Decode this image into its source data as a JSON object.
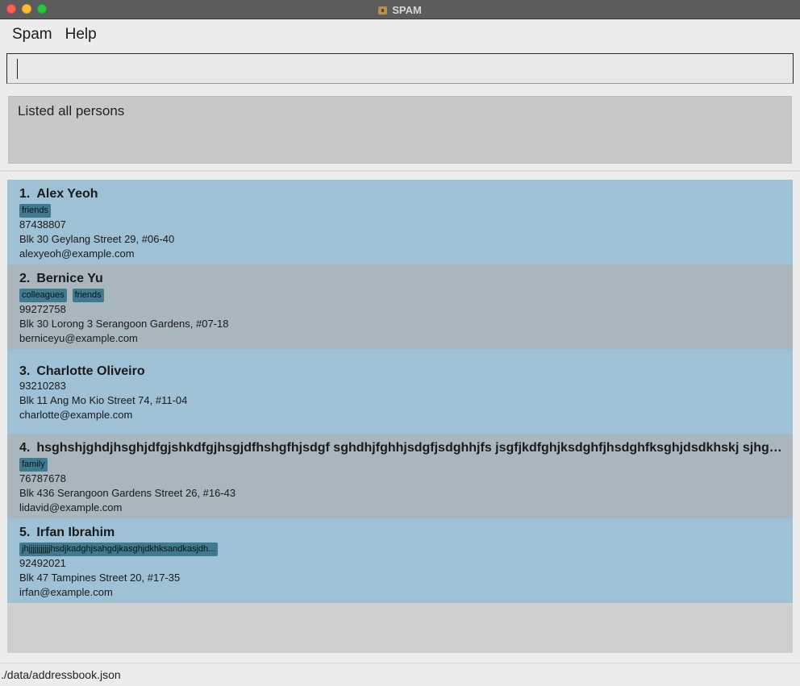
{
  "window": {
    "title": "SPAM"
  },
  "menu": {
    "items": [
      "Spam",
      "Help"
    ]
  },
  "command": {
    "value": ""
  },
  "result": {
    "text": "Listed all persons"
  },
  "persons": [
    {
      "index": "1.",
      "name": "Alex Yeoh",
      "tags": [
        "friends"
      ],
      "phone": "87438807",
      "address": "Blk 30 Geylang Street 29, #06-40",
      "email": "alexyeoh@example.com"
    },
    {
      "index": "2.",
      "name": "Bernice Yu",
      "tags": [
        "colleagues",
        "friends"
      ],
      "phone": "99272758",
      "address": "Blk 30 Lorong 3 Serangoon Gardens, #07-18",
      "email": "berniceyu@example.com"
    },
    {
      "index": "3.",
      "name": "Charlotte Oliveiro",
      "tags": [],
      "phone": "93210283",
      "address": "Blk 11 Ang Mo Kio Street 74, #11-04",
      "email": "charlotte@example.com"
    },
    {
      "index": "4.",
      "name": "hsghshjghdjhsghjdfgjshkdfgjhsgjdfhshgfhjsdgf sghdhjfghhjsdgfjsdghhjfs jsgfjkdfghjksdghfjhsdghfksghjdsdkhskj sjhgfdj...",
      "tags": [
        "family"
      ],
      "phone": "76787678",
      "address": "Blk 436 Serangoon Gardens Street 26, #16-43",
      "email": "lidavid@example.com"
    },
    {
      "index": "5.",
      "name": "Irfan Ibrahim",
      "tags": [
        "jhjjjjjjjjjjjhsdjkadghjsahgdjkasghjdkhksandkasjdh..."
      ],
      "phone": "92492021",
      "address": "Blk 47 Tampines Street 20, #17-35",
      "email": "irfan@example.com"
    }
  ],
  "status": {
    "path": "./data/addressbook.json"
  },
  "colors": {
    "card_odd": "#9fc1d5",
    "card_even": "#a9b6bd",
    "tag": "#3e7b91"
  }
}
